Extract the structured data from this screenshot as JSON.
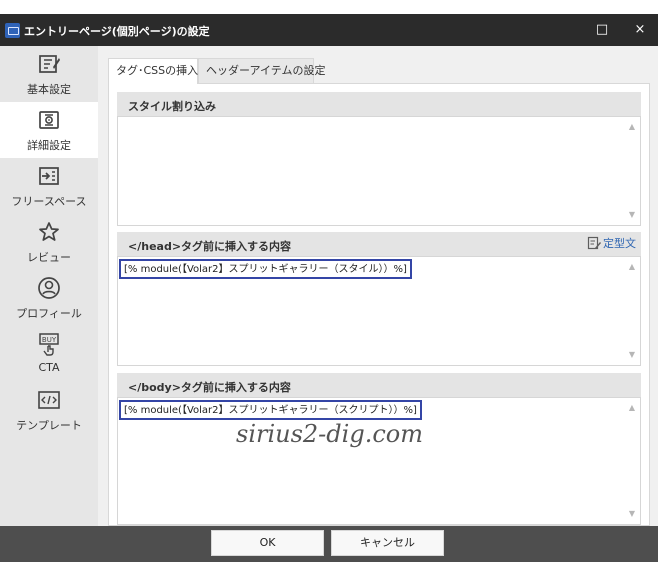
{
  "window": {
    "title": "エントリーページ(個別ページ)の設定",
    "maximize_glyph": "□",
    "close_glyph": "×"
  },
  "sidebar": {
    "items": [
      {
        "label": "基本設定",
        "icon": "edit-icon"
      },
      {
        "label": "詳細設定",
        "icon": "settings-icon"
      },
      {
        "label": "フリースペース",
        "icon": "insert-text-icon"
      },
      {
        "label": "レビュー",
        "icon": "star-icon"
      },
      {
        "label": "プロフィール",
        "icon": "user-icon"
      },
      {
        "label": "CTA",
        "icon": "buy-click-icon"
      },
      {
        "label": "テンプレート",
        "icon": "code-icon"
      }
    ],
    "active_index": 1
  },
  "tabs": [
    {
      "label": "タグ･CSSの挿入",
      "active": true
    },
    {
      "label": "ヘッダーアイテムの設定",
      "active": false
    }
  ],
  "sections": {
    "style": {
      "title": "スタイル割り込み",
      "value": ""
    },
    "head": {
      "title": "</head>タグ前に挿入する内容",
      "template_label": "定型文",
      "value": "[% module(【Volar2】スプリットギャラリー（スタイル））%]"
    },
    "body": {
      "title": "</body>タグ前に挿入する内容",
      "value": "[% module(【Volar2】スプリットギャラリー（スクリプト））%]"
    }
  },
  "watermark": "sirius2-dig.com",
  "buttons": {
    "ok": "OK",
    "cancel": "キャンセル"
  },
  "colors": {
    "title_bar": "#2b2b2b",
    "accent_blue": "#3445a6",
    "template_blue": "#2f66b2",
    "bottom_bar": "#4e4e4e"
  }
}
